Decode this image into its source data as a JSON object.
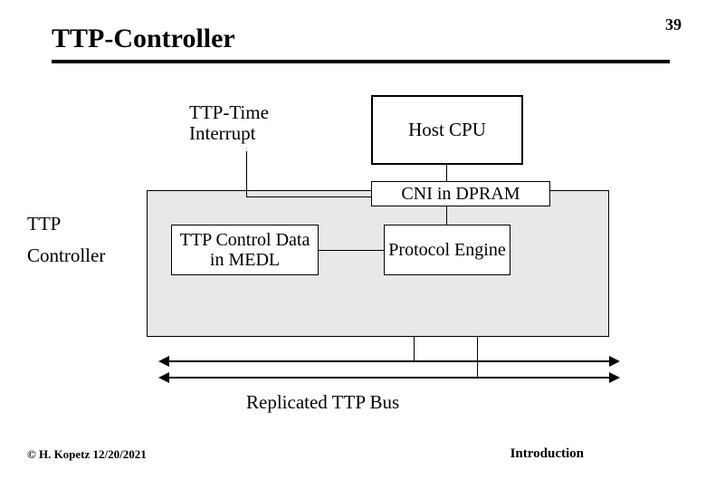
{
  "page_number": "39",
  "title": "TTP-Controller",
  "labels": {
    "ttp_time": "TTP-Time Interrupt",
    "host_cpu": "Host CPU",
    "cni": "CNI in DPRAM",
    "medl": "TTP Control Data in MEDL",
    "protocol_engine": "Protocol Engine",
    "side_ttp": "TTP",
    "side_controller": "Controller",
    "bus": "Replicated TTP Bus"
  },
  "footer": {
    "left": "© H. Kopetz 12/20/2021",
    "right": "Introduction"
  }
}
